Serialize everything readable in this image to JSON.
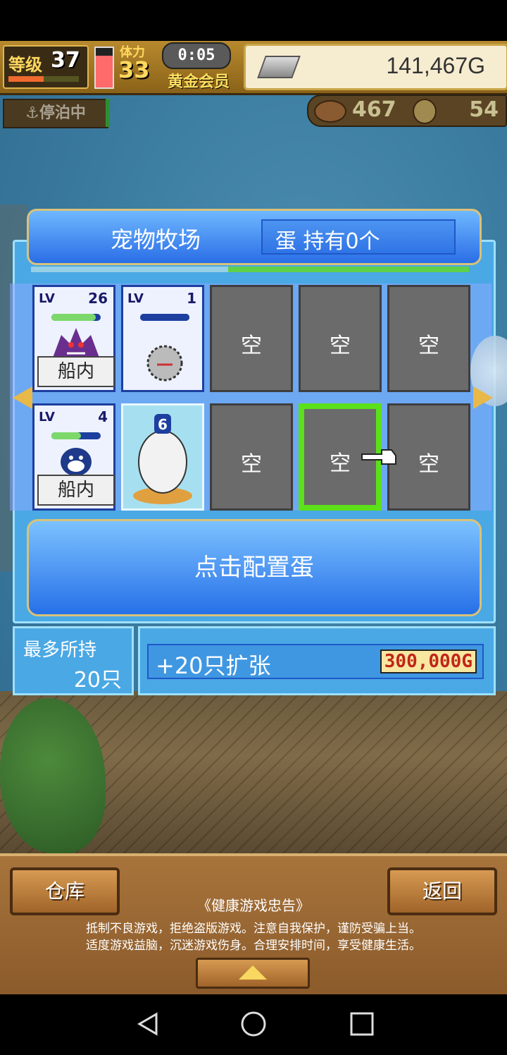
{
  "hud": {
    "level_label": "等级",
    "level": "37",
    "level_progress": 0.5,
    "stamina_label": "体力",
    "stamina": "33",
    "stamina_fill": 0.8,
    "timer": "0:05",
    "member": "黄金会员",
    "gold": "141,467G",
    "docked": "⚓停泊中",
    "resource1": "467",
    "resource2": "54"
  },
  "ranch": {
    "title": "宠物牧场",
    "egg_status": "蛋 持有0个",
    "progress": 0.55,
    "empty_label": "空",
    "pets": [
      {
        "level_tag": "LV",
        "level": "26",
        "location": "船内",
        "hp": 0.9
      },
      {
        "level_tag": "LV",
        "level": "1",
        "location": "",
        "hp": 1.0
      },
      {
        "level_tag": "LV",
        "level": "4",
        "location": "船内",
        "hp": 0.6
      }
    ],
    "egg_badge": "6",
    "config_button": "点击配置蛋"
  },
  "capacity": {
    "label": "最多所持",
    "value": "20只"
  },
  "expand": {
    "label": "+20只扩张",
    "price": "300,000G"
  },
  "bottom": {
    "warehouse": "仓库",
    "back": "返回",
    "notice_title": "《健康游戏忠告》",
    "notice_line1": "抵制不良游戏，拒绝盗版游戏。注意自我保护，谨防受骗上当。",
    "notice_line2": "适度游戏益脑，沉迷游戏伤身。合理安排时间，享受健康生活。"
  },
  "icons": {
    "gold": "gold-bar-icon",
    "anchor": "anchor-icon",
    "back": "nav-back-icon",
    "home": "nav-home-icon",
    "recent": "nav-recent-icon"
  }
}
